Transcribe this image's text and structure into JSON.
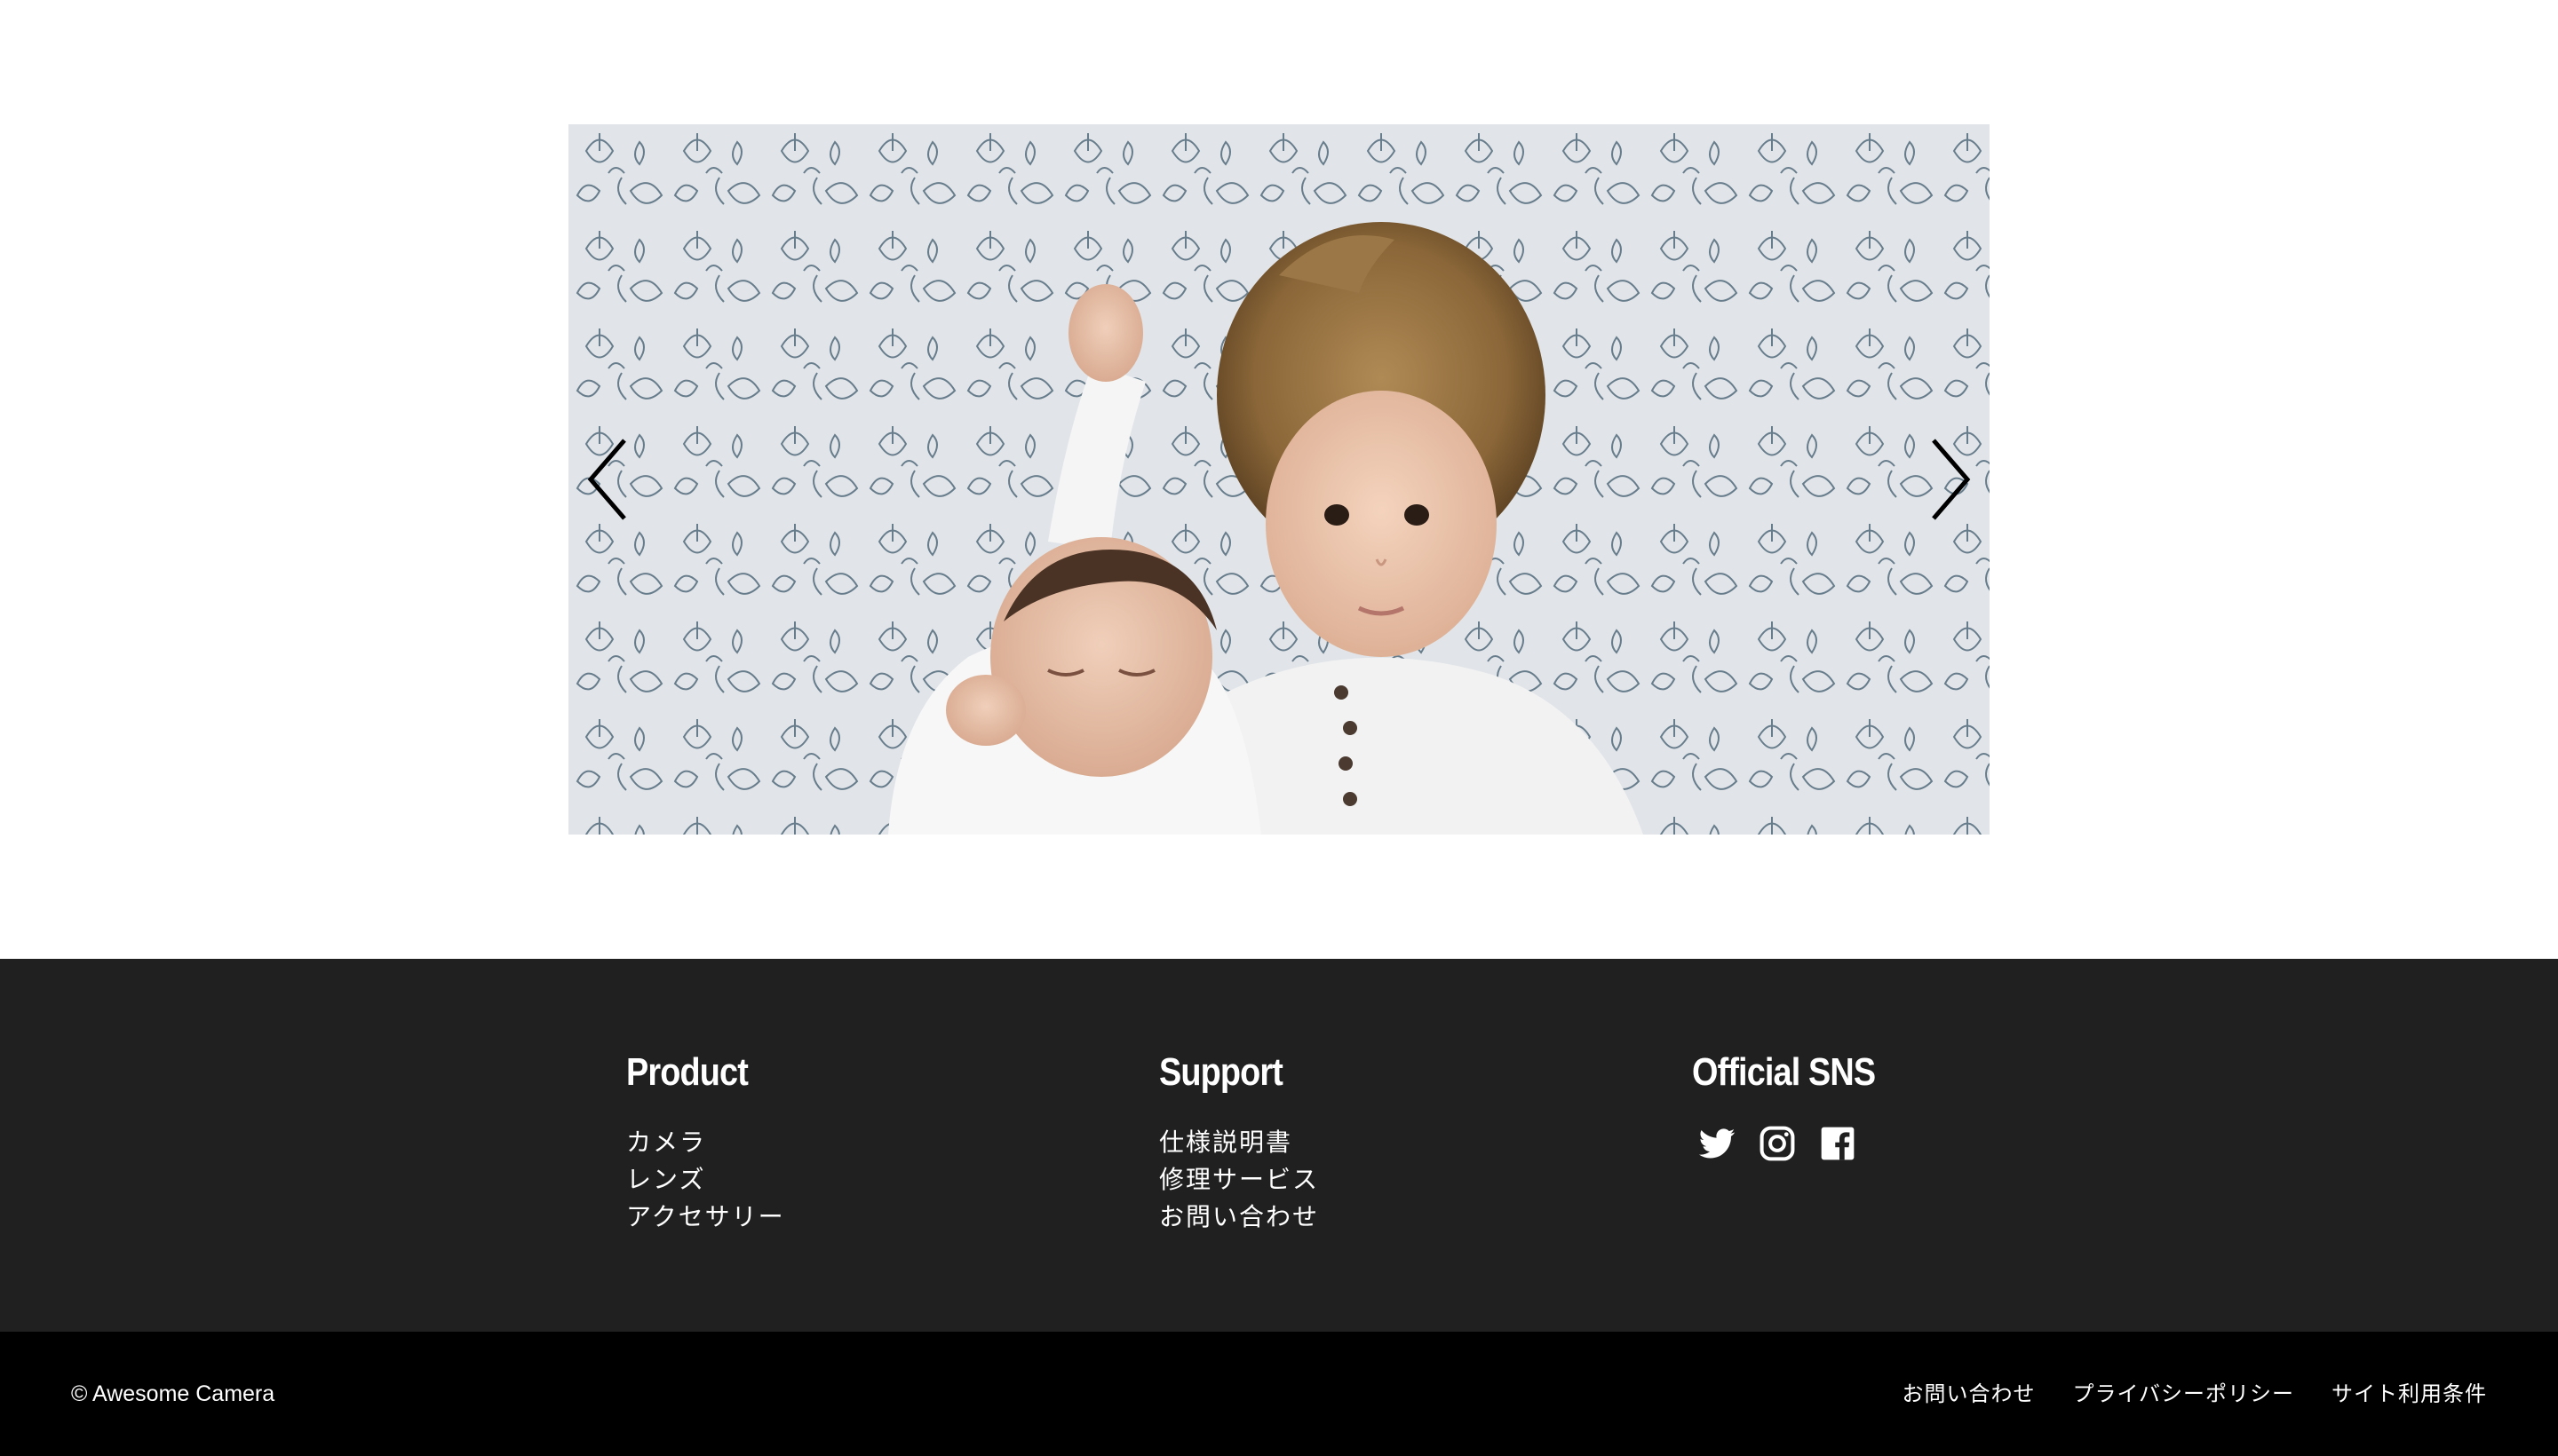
{
  "carousel": {
    "prev_icon": "chevron-left-icon",
    "next_icon": "chevron-right-icon",
    "slide_count": 3,
    "active_slide": 1
  },
  "footer": {
    "background": "#202020",
    "columns": [
      {
        "heading": "Product",
        "links": [
          "カメラ",
          "レンズ",
          "アクセサリー"
        ]
      },
      {
        "heading": "Support",
        "links": [
          "仕様説明書",
          "修理サービス",
          "お問い合わせ"
        ]
      },
      {
        "heading": "Official SNS",
        "icons": [
          "twitter-icon",
          "instagram-icon",
          "facebook-icon"
        ]
      }
    ]
  },
  "bottom_bar": {
    "background": "#000000",
    "copyright": "© Awesome Camera",
    "links": [
      "お問い合わせ",
      "プライバシーポリシー",
      "サイト利用条件"
    ]
  }
}
